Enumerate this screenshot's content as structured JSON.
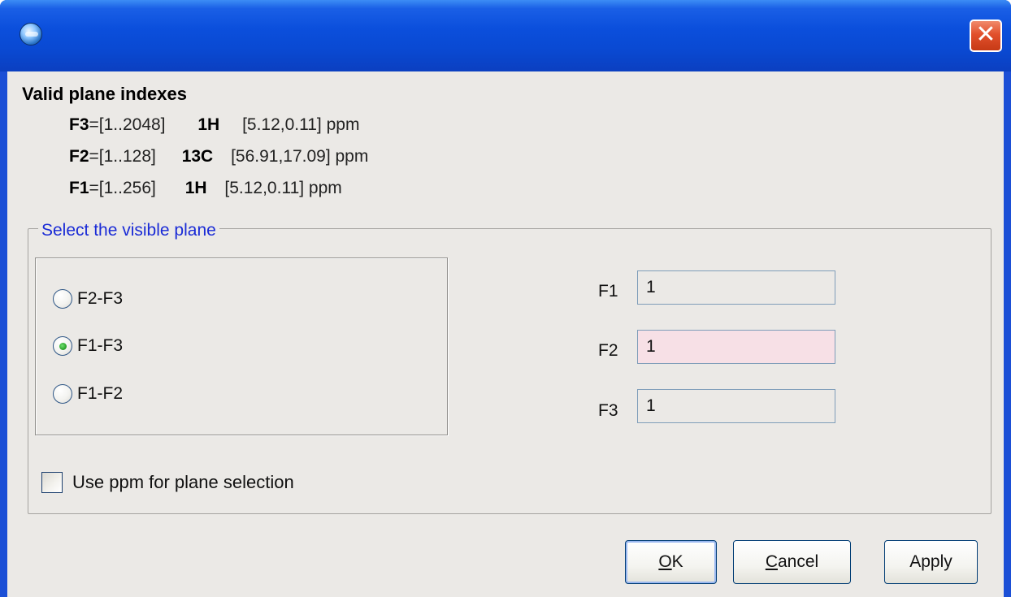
{
  "window": {
    "title": "",
    "app_icon": "nmr-globe-icon",
    "close_icon": "close-icon",
    "close_glyph": "✕",
    "accent": "#0b4fdc"
  },
  "info": {
    "title": "Valid plane indexes",
    "lines": [
      {
        "dim": "F3",
        "range": "=[1..2048]",
        "nucleus": "1H",
        "ppm": "[5.12,0.11] ppm"
      },
      {
        "dim": "F2",
        "range": "=[1..128]",
        "nucleus": "13C",
        "ppm": "[56.91,17.09] ppm"
      },
      {
        "dim": "F1",
        "range": "=[1..256]",
        "nucleus": "1H",
        "ppm": "[5.12,0.11] ppm"
      }
    ]
  },
  "plane_group": {
    "title": "Select the visible plane",
    "title_color": "#1a2bd6",
    "options": [
      {
        "label": "F2-F3",
        "checked": false
      },
      {
        "label": "F1-F3",
        "checked": true
      },
      {
        "label": "F1-F2",
        "checked": false
      }
    ],
    "fields": [
      {
        "label": "F1",
        "value": "1"
      },
      {
        "label": "F2",
        "value": "1"
      },
      {
        "label": "F3",
        "value": "1"
      }
    ],
    "use_ppm_label": "Use ppm for plane selection",
    "use_ppm_checked": false
  },
  "buttons": {
    "ok": {
      "mnemonic": "O",
      "rest": "K"
    },
    "cancel": {
      "mnemonic": "C",
      "rest": "ancel"
    },
    "apply": "Apply"
  }
}
